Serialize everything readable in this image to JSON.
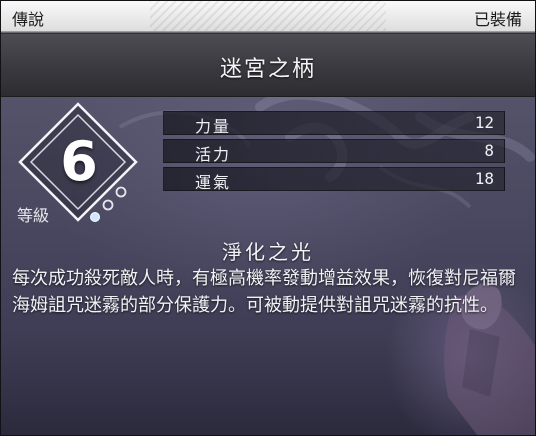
{
  "header": {
    "rarity": "傳說",
    "status": "已裝備"
  },
  "item": {
    "name": "迷宮之柄"
  },
  "level": {
    "label": "等級",
    "value": "6"
  },
  "stats": [
    {
      "name": "力量",
      "value": "12"
    },
    {
      "name": "活力",
      "value": "8"
    },
    {
      "name": "運氣",
      "value": "18"
    }
  ],
  "ability": {
    "title": "淨化之光",
    "description": "每次成功殺死敵人時，有極高機率發動增益效果，恢復對尼福爾海姆詛咒迷霧的部分保護力。可被動提供對詛咒迷霧的抗性。"
  },
  "colors": {
    "accent": "#cfe8ff",
    "panel": "#4a4860",
    "topbar": "#eeeeee"
  }
}
